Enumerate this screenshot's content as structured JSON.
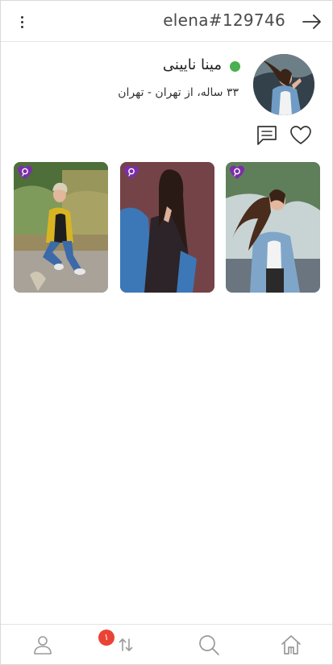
{
  "header": {
    "username": "elena#129746",
    "menu_icon": "more-vertical-icon",
    "back_icon": "arrow-right-icon"
  },
  "profile": {
    "name": "مینا نایینی",
    "info": "۳۳ ساله، از تهران - تهران",
    "online": true,
    "online_color": "#4caf50",
    "avatar_icon": "profile-photo"
  },
  "actions": {
    "like_icon": "heart-icon",
    "message_icon": "message-icon"
  },
  "gallery": {
    "photos": [
      {
        "badge_icon": "purple-heart-badge-icon"
      },
      {
        "badge_icon": "purple-heart-badge-icon"
      },
      {
        "badge_icon": "purple-heart-badge-icon"
      }
    ],
    "badge_color": "#7b2fa8"
  },
  "bottom_nav": {
    "items": [
      {
        "icon": "user-icon"
      },
      {
        "icon": "transfer-arrows-icon"
      },
      {
        "icon": "search-icon"
      },
      {
        "icon": "home-icon"
      }
    ],
    "notification_count": "۱",
    "badge_color": "#ea4335"
  }
}
